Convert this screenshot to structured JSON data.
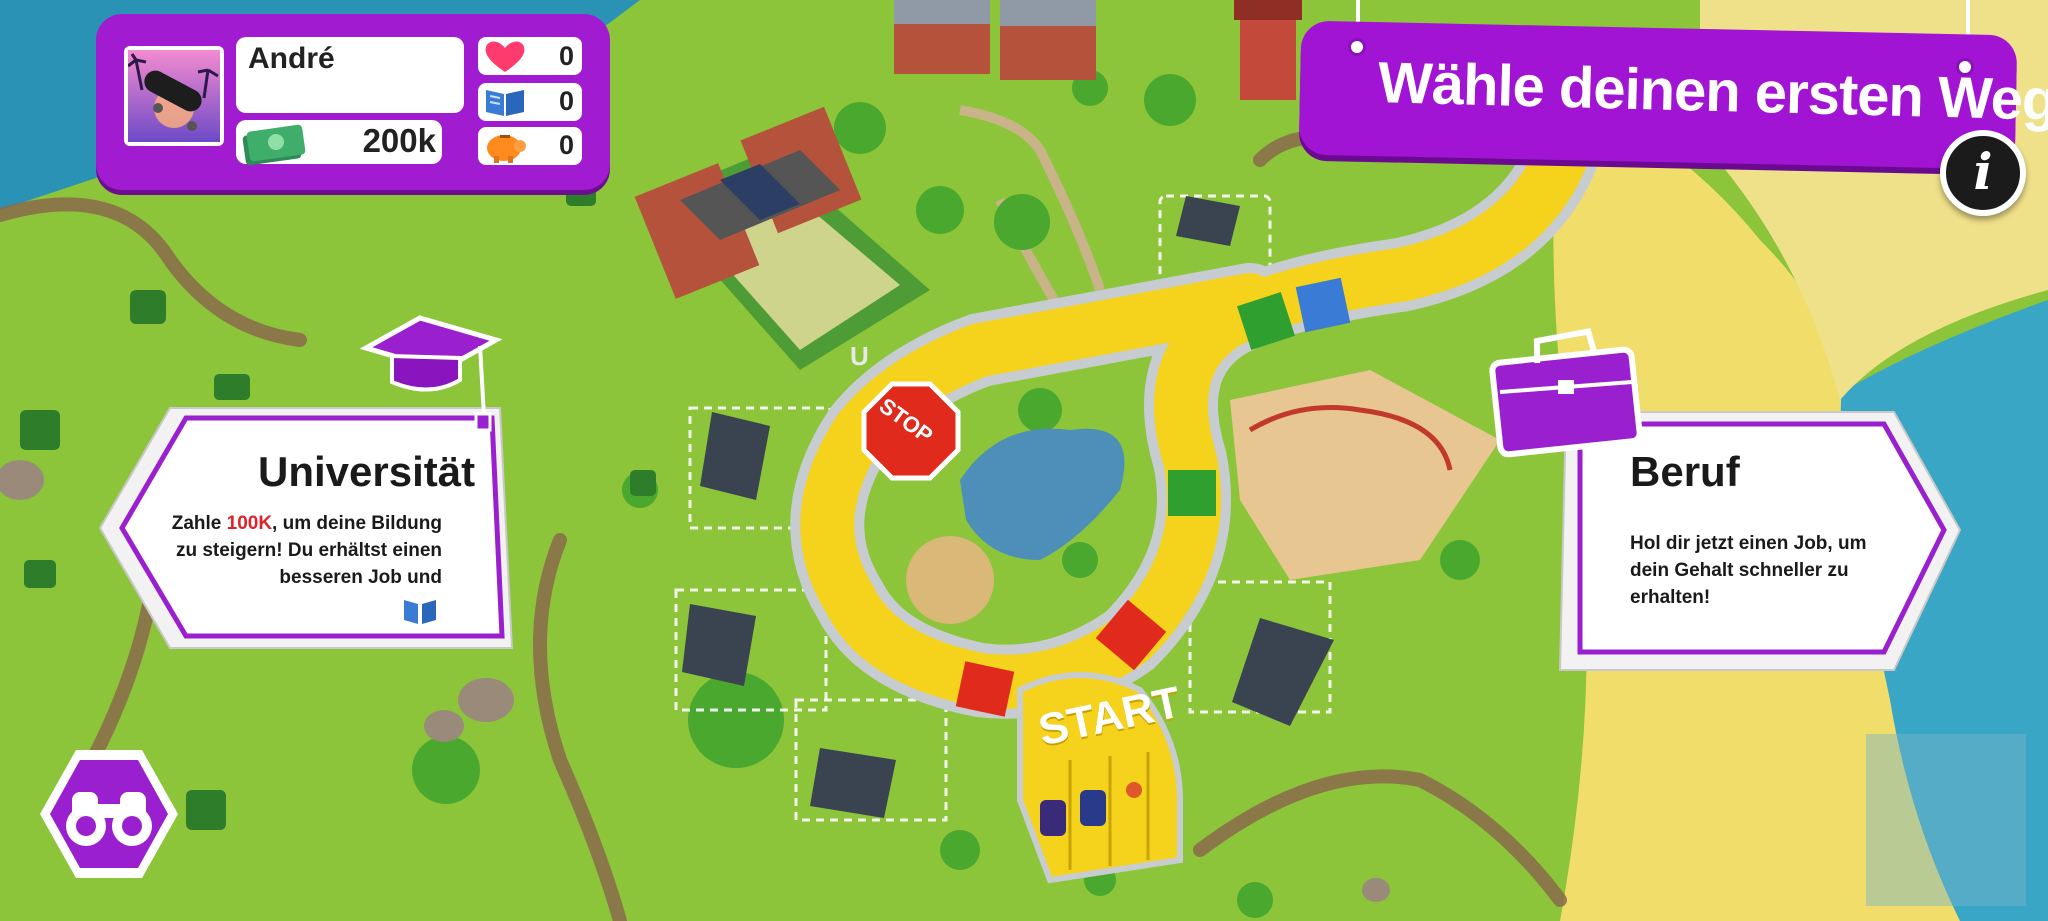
{
  "player": {
    "name": "André",
    "money": "200k",
    "stats": [
      {
        "icon": "heart-icon",
        "value": "0",
        "color": "#ff3b6e"
      },
      {
        "icon": "book-icon",
        "value": "0",
        "color": "#3a7bd5"
      },
      {
        "icon": "piggy-bank-icon",
        "value": "0",
        "color": "#ff8a1e"
      }
    ]
  },
  "banner": {
    "title": "Wähle deinen ersten Weg",
    "info_label": "i"
  },
  "choices": {
    "university": {
      "title": "Universität",
      "desc_pre": "Zahle ",
      "desc_highlight": "100K",
      "desc_post": ", um deine Bildung zu steigern! Du erhältst einen besseren Job und",
      "icon": "graduation-cap-icon"
    },
    "career": {
      "title": "Beruf",
      "desc": "Hol dir jetzt einen Job, um dein Gehalt schneller zu erhalten!",
      "icon": "briefcase-icon"
    }
  },
  "board": {
    "start_label": "START",
    "stop_label": "STOP"
  },
  "colors": {
    "accent": "#a114d4",
    "grass": "#8cc43a",
    "board_yellow": "#f5d21c",
    "board_red": "#e02b1c",
    "board_green": "#2fa02f"
  }
}
